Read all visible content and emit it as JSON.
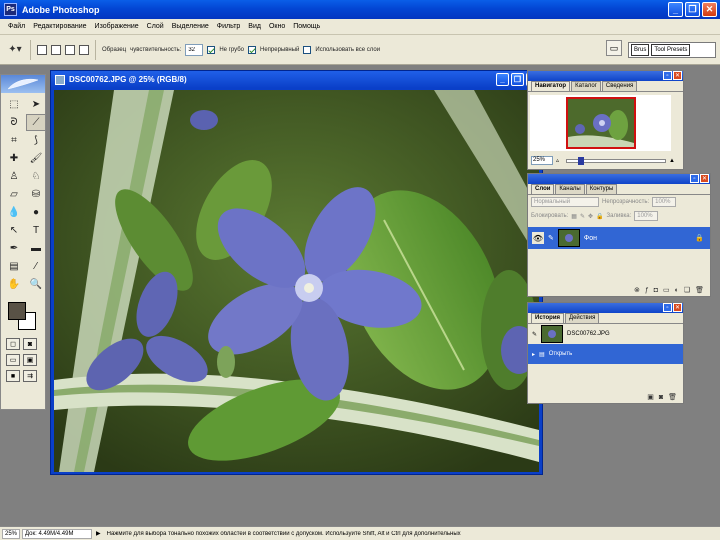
{
  "window": {
    "title": "Adobe Photoshop",
    "app_icon": "Ps"
  },
  "menu": [
    "Файл",
    "Редактирование",
    "Изображение",
    "Слой",
    "Выделение",
    "Фильтр",
    "Вид",
    "Окно",
    "Помощь"
  ],
  "options": {
    "tolerance_label": "Образец",
    "tolerance_label2": "чувствительность:",
    "tolerance_value": "32",
    "anti_alias": "Не грубо",
    "contiguous": "Непрерывный",
    "all_layers": "Использовать все слои",
    "palette_tabs": [
      "Brus",
      "Tool Presets"
    ],
    "palette_more": "Lay"
  },
  "document": {
    "title": "DSC00762.JPG @ 25% (RGB/8)"
  },
  "navigator": {
    "tabs": [
      "Навигатор",
      "Каталог",
      "Сведения"
    ],
    "zoom": "25%",
    "zoom_level": 0.12
  },
  "layers": {
    "tabs": [
      "Слои",
      "Каналы",
      "Контуры"
    ],
    "blend_mode": "Нормальный",
    "opacity_label": "Непрозрачность:",
    "opacity_value": "100%",
    "lock_label": "Блокировать:",
    "fill_label": "Заливка:",
    "fill_value": "100%",
    "layer_name": "Фон"
  },
  "history": {
    "tabs": [
      "История",
      "Действия"
    ],
    "snapshot": "DSC00762.JPG",
    "item": "Открыть"
  },
  "status": {
    "zoom": "25%",
    "doc_size": "Док: 4.49M/4.49M",
    "hint": "Нажмите для выбора тонально похожих областей в соответствии с допуском. Используйте Shift, Alt и Ctrl для дополнительных"
  },
  "colors": {
    "titlebar": "#0346d4",
    "selection": "#3166d4",
    "foreground": "#595246",
    "background": "#ffffff"
  }
}
